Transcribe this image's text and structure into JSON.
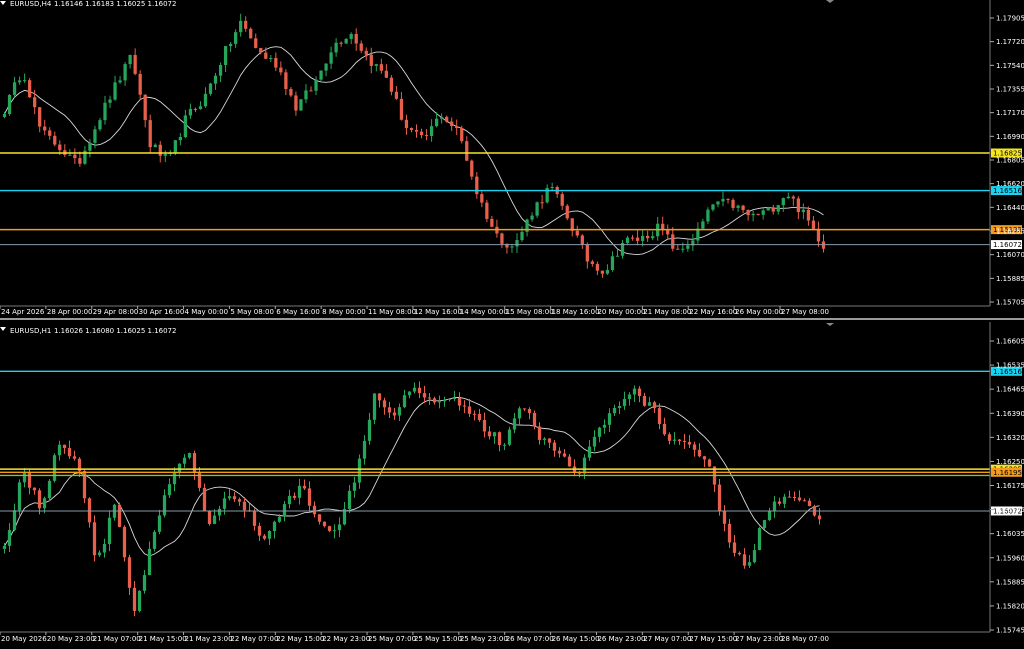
{
  "colors": {
    "background": "#000000",
    "bull": "#26a65b",
    "bear": "#e8604c",
    "ma": "#d9d9d9",
    "axis_text": "#ffffff",
    "divider": "#9a9a9a"
  },
  "panels": [
    {
      "id": "h4",
      "symbol_title": "EURUSD,H4",
      "ohlc": "1.16146 1.16183 1.16025 1.16072",
      "price_range": [
        1.156,
        1.1805
      ],
      "price_ticks": [
        "1.17905",
        "1.17720",
        "1.17540",
        "1.17355",
        "1.17170",
        "1.16990",
        "1.16805",
        "1.16620",
        "1.16440",
        "1.16255",
        "1.16070",
        "1.15885",
        "1.15705"
      ],
      "time_labels": [
        "24 Apr 2026",
        "28 Apr 00:00",
        "29 Apr 08:00",
        "30 Apr 16:00",
        "4 May 00:00",
        "5 May 08:00",
        "6 May 16:00",
        "8 May 00:00",
        "11 May 08:00",
        "12 May 16:00",
        "14 May 00:00",
        "15 May 08:00",
        "18 May 16:00",
        "20 May 00:00",
        "21 May 08:00",
        "22 May 16:00",
        "26 May 00:00",
        "27 May 08:00"
      ],
      "levels": [
        {
          "name": "yellow-level",
          "price": 1.16825,
          "label": "1.16825",
          "color": "#f5e625",
          "label_text_color": "#000000"
        },
        {
          "name": "cyan-level",
          "price": 1.16516,
          "label": "1.16516",
          "color": "#19d3f0",
          "label_text_color": "#000000"
        },
        {
          "name": "orange-level",
          "price": 1.16195,
          "label": "1.16195",
          "color": "#f59a1a",
          "label_text_color": "#000000"
        },
        {
          "name": "current-price",
          "price": 1.16072,
          "label": "1.16072",
          "color": "#8a9aa8",
          "label_text_color": "#000000"
        }
      ],
      "candle_count": 164,
      "candle_waypoints": [
        1.1718,
        1.1752,
        1.17,
        1.1688,
        1.1672,
        1.1705,
        1.1735,
        1.1762,
        1.169,
        1.1675,
        1.1712,
        1.1728,
        1.1762,
        1.179,
        1.1765,
        1.1755,
        1.172,
        1.1738,
        1.177,
        1.1782,
        1.176,
        1.1745,
        1.1705,
        1.1692,
        1.1715,
        1.1698,
        1.1648,
        1.1615,
        1.1605,
        1.1635,
        1.1655,
        1.1628,
        1.1595,
        1.1585,
        1.161,
        1.1612,
        1.1622,
        1.16,
        1.1615,
        1.1642,
        1.164,
        1.163,
        1.1635,
        1.165,
        1.163,
        1.1607
      ]
    },
    {
      "id": "h1",
      "symbol_title": "EURUSD,H1",
      "ohlc": "1.16026 1.16080 1.16025 1.16072",
      "price_range": [
        1.157,
        1.1666
      ],
      "price_ticks": [
        "1.16605",
        "1.16535",
        "1.16465",
        "1.16390",
        "1.16320",
        "1.16250",
        "1.16175",
        "1.16105",
        "1.16035",
        "1.15960",
        "1.15885",
        "1.15820",
        "1.15745"
      ],
      "time_labels": [
        "20 May 2026",
        "20 May 23:00",
        "21 May 07:00",
        "21 May 15:00",
        "21 May 23:00",
        "22 May 07:00",
        "22 May 15:00",
        "22 May 23:00",
        "25 May 07:00",
        "25 May 15:00",
        "25 May 23:00",
        "26 May 07:00",
        "26 May 15:00",
        "26 May 23:00",
        "27 May 07:00",
        "27 May 15:00",
        "27 May 23:00",
        "28 May 07:00"
      ],
      "levels": [
        {
          "name": "cyan-level",
          "price": 1.16516,
          "label": "1.16516",
          "color": "#19d3f0",
          "label_text_color": "#000000"
        },
        {
          "name": "yellow-level",
          "price": 1.16205,
          "label": "1.16205",
          "color": "#f5e625",
          "label_text_color": "#000000"
        },
        {
          "name": "orange-level",
          "price": 1.16195,
          "label": "1.16195",
          "color": "#f59a1a",
          "label_text_color": "#000000"
        },
        {
          "name": "green-level",
          "price": 1.16185,
          "label": "",
          "color": "#7bd11a",
          "label_text_color": "#000000"
        },
        {
          "name": "current-price",
          "price": 1.16072,
          "label": "1.16072",
          "color": "#8a9aa8",
          "label_text_color": "#000000"
        }
      ],
      "candle_count": 164,
      "candle_waypoints": [
        1.1596,
        1.162,
        1.1608,
        1.163,
        1.1622,
        1.159,
        1.161,
        1.1575,
        1.1598,
        1.1618,
        1.1625,
        1.1603,
        1.1612,
        1.1608,
        1.1598,
        1.1608,
        1.1615,
        1.1605,
        1.16,
        1.162,
        1.1645,
        1.1638,
        1.1648,
        1.1642,
        1.1644,
        1.164,
        1.1633,
        1.1628,
        1.1642,
        1.163,
        1.1625,
        1.162,
        1.1632,
        1.164,
        1.1645,
        1.164,
        1.1628,
        1.163,
        1.1622,
        1.16,
        1.1588,
        1.1605,
        1.1612,
        1.161,
        1.1604
      ]
    }
  ]
}
